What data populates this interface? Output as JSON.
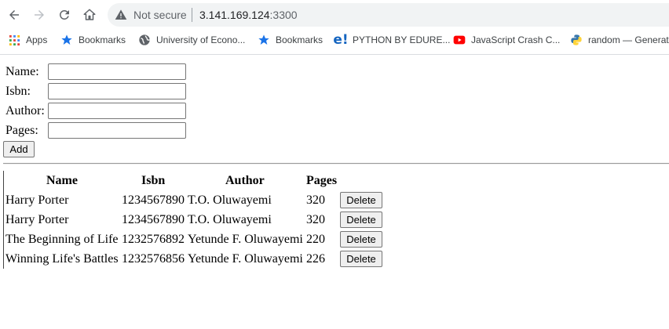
{
  "browser": {
    "security_label": "Not secure",
    "url_host": "3.141.169.124",
    "url_port": ":3300"
  },
  "bookmarks": [
    {
      "label": "Apps",
      "icon": "apps-grid-icon"
    },
    {
      "label": "Bookmarks",
      "icon": "star-icon"
    },
    {
      "label": "University of Econo...",
      "icon": "globe-icon"
    },
    {
      "label": "Bookmarks",
      "icon": "star-icon"
    },
    {
      "label": "PYTHON BY EDURE...",
      "icon": "edureka-icon"
    },
    {
      "label": "JavaScript Crash C...",
      "icon": "youtube-icon"
    },
    {
      "label": "random — Generat",
      "icon": "python-icon"
    }
  ],
  "form": {
    "name_label": "Name:",
    "isbn_label": "Isbn:",
    "author_label": "Author:",
    "pages_label": "Pages:",
    "name_value": "",
    "isbn_value": "",
    "author_value": "",
    "pages_value": "",
    "add_label": "Add"
  },
  "table": {
    "headers": [
      "Name",
      "Isbn",
      "Author",
      "Pages"
    ],
    "rows": [
      {
        "name": "Harry Porter",
        "isbn": "1234567890",
        "author": "T.O. Oluwayemi",
        "pages": "320",
        "action": "Delete"
      },
      {
        "name": "Harry Porter",
        "isbn": "1234567890",
        "author": "T.O. Oluwayemi",
        "pages": "320",
        "action": "Delete"
      },
      {
        "name": "The Beginning of Life",
        "isbn": "1232576892",
        "author": "Yetunde F. Oluwayemi",
        "pages": "220",
        "action": "Delete"
      },
      {
        "name": "Winning Life's Battles",
        "isbn": "1232576856",
        "author": "Yetunde F. Oluwayemi",
        "pages": "226",
        "action": "Delete"
      }
    ]
  }
}
